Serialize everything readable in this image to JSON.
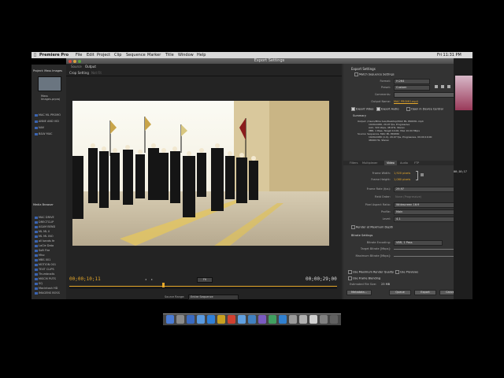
{
  "menubar": {
    "items": [
      "Premiere Pro",
      "File",
      "Edit",
      "Project",
      "Clip",
      "Sequence",
      "Marker",
      "Title",
      "Window",
      "Help"
    ],
    "clock": "Fri 11:31 PM"
  },
  "export_window": {
    "title": "Export Settings",
    "tabs": [
      "Source",
      "Output"
    ],
    "crop_tabs": [
      "Crop Setting",
      "Not Fit"
    ],
    "timecode_in": "00;00;10;11",
    "timecode_out": "00;00;29;00",
    "source_range_label": "Source Range:",
    "source_range_value": "Entire Sequence",
    "fit_label": "Fit"
  },
  "settings": {
    "export_settings_heading": "Export Settings",
    "match_sequence_label": "Match Sequence Settings",
    "format_label": "Format:",
    "format_value": "H.264",
    "preset_label": "Preset:",
    "preset_value": "Custom",
    "comments_label": "Comments:",
    "output_name_label": "Output Name:",
    "output_name_value": "MAC PROMO.mp4",
    "export_video_label": "Export Video",
    "export_audio_label": "Export Audio",
    "open_in_device_central": "Open in Device Central",
    "summary_heading": "Summary",
    "summary_lines": [
      "Output: /Users/Mike Ives/Desktop/MAC ML PROMO..mp4",
      "1920x1080, 29.97 fps, Progressive",
      "AAC, 320 kbps, 48 kHz, Stereo",
      "VBR, 1 Pass, Target 10.00, Max 10.00 Mbps",
      "Source: Sequence, MAC ML PROMO",
      "1920x1080 (1.0), 29.97 fps, Progressive, 00;00;19;00",
      "48000 Hz, Stereo"
    ],
    "sub_tabs": [
      "Filters",
      "Multiplexer",
      "Video",
      "Audio",
      "FTP"
    ],
    "frame_width_label": "Frame Width:",
    "frame_width_value": "1,920 pixels",
    "frame_height_label": "Frame Height:",
    "frame_height_value": "1,080 pixels",
    "frame_rate_label": "Frame Rate (fps):",
    "frame_rate_value": "29.97",
    "field_order_label": "Field Order:",
    "field_order_value": "None (Progressive)",
    "pixel_aspect_label": "Pixel Aspect Ratio:",
    "pixel_aspect_value": "Widescreen 16:9",
    "profile_label": "Profile:",
    "profile_value": "Main",
    "level_label": "Level:",
    "level_value": "4.1",
    "render_max_depth": "Render at Maximum Depth",
    "bitrate_heading": "Bitrate Settings",
    "bitrate_encoding_label": "Bitrate Encoding:",
    "bitrate_encoding_value": "VBR, 1 Pass",
    "target_bitrate_label": "Target Bitrate [Mbps]:",
    "target_bitrate_value": "10",
    "max_bitrate_label": "Maximum Bitrate [Mbps]:",
    "max_bitrate_value": "10",
    "use_max_render_quality": "Use Maximum Render Quality",
    "use_previews": "Use Previews",
    "use_frame_blending": "Use Frame Blending",
    "estimated_size_label": "Estimated File Size:",
    "estimated_size_value": "23 MB",
    "metadata_button": "Metadata...",
    "queue_button": "Queue",
    "export_button": "Export",
    "cancel_button": "Cancel"
  },
  "project_panel": {
    "title": "Project: Mass Images",
    "item_title": "Mass Images.prproj",
    "items": [
      "MAC ML PROMO",
      "ANNE AND VID",
      "NAV",
      "B&W MAC"
    ],
    "browser_title": "Media Browser",
    "browser_items": [
      "MAC DRIVE",
      "DRECTCLIP",
      "ASAM BEND",
      "ML ML II",
      "ML ML INO",
      "all bands fe",
      "LaCie Data",
      "Soft Fire",
      "Misc",
      "MBS 001",
      "MOTION 001",
      "TEXT CLIPS",
      "Thumbnails",
      "MISCM PUTS",
      "SQ",
      "Macintosh HD",
      "IMAGENS BOSS"
    ]
  },
  "right_strip": {
    "clock": "00;16;17"
  }
}
